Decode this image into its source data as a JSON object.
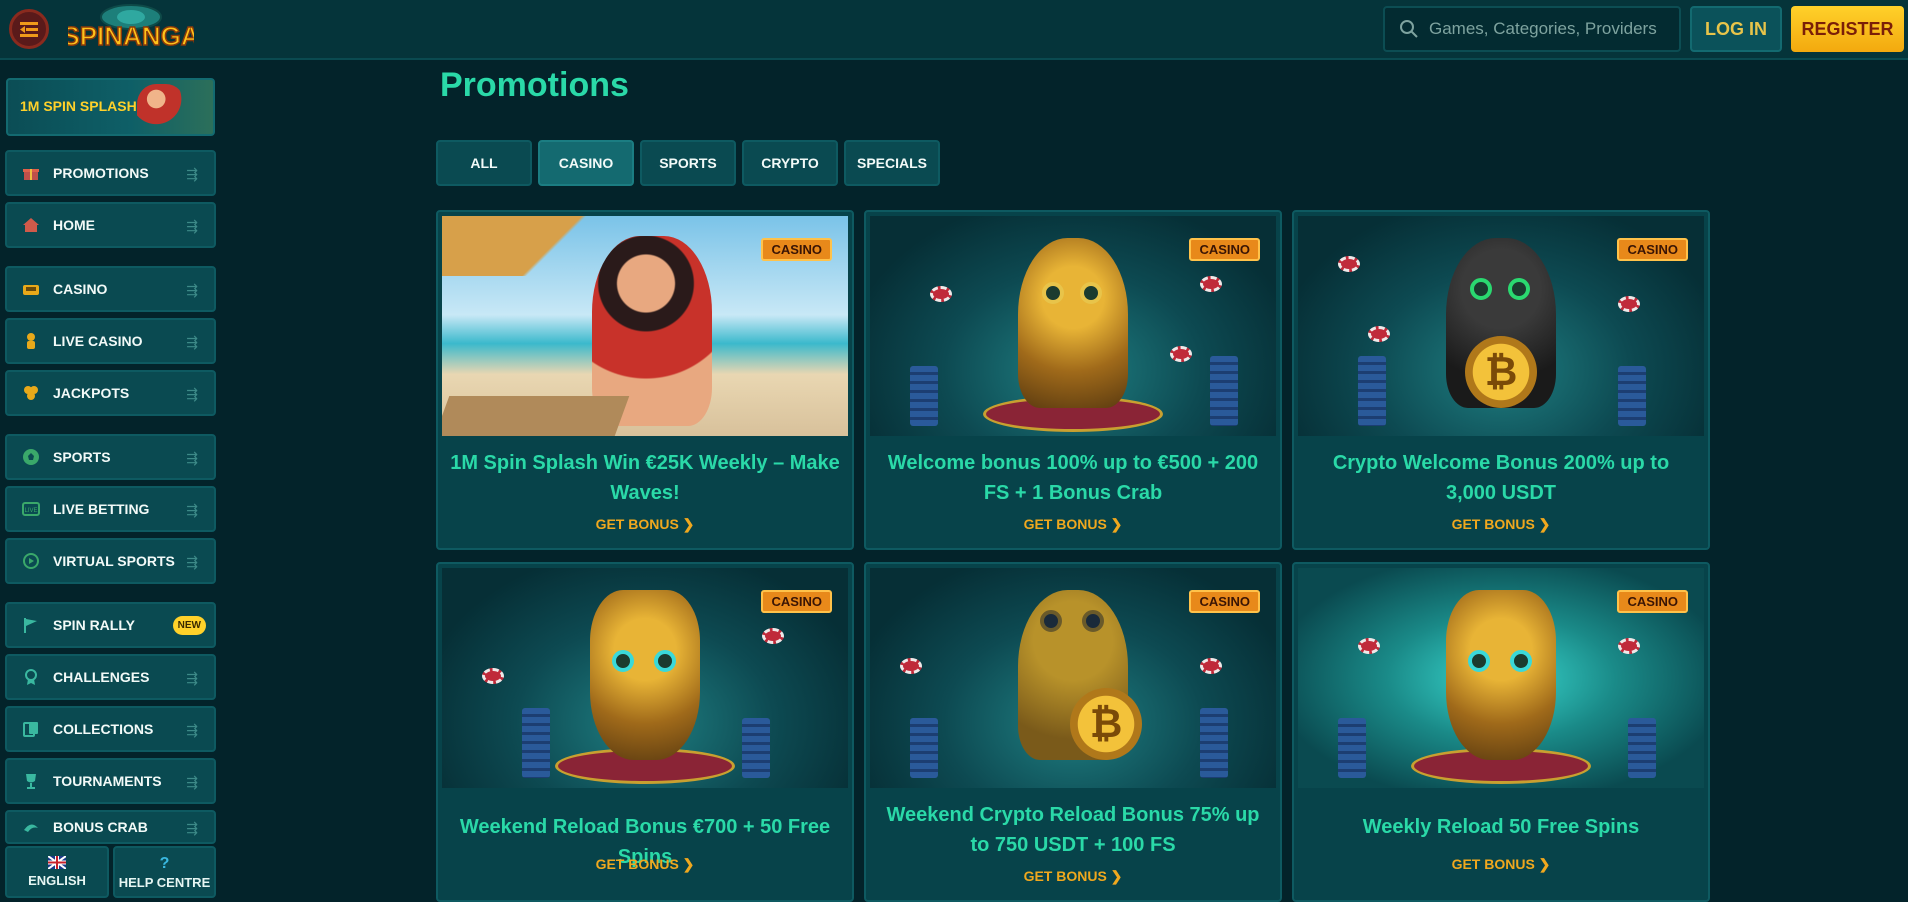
{
  "header": {
    "logo_text": "SPINANGA",
    "search_placeholder": "Games, Categories, Providers",
    "login_label": "LOG IN",
    "register_label": "REGISTER"
  },
  "sidebar": {
    "banner_label": "1M SPIN SPLASH",
    "items": [
      {
        "label": "PROMOTIONS",
        "icon": "gift-icon"
      },
      {
        "label": "HOME",
        "icon": "home-icon"
      },
      {
        "label": "CASINO",
        "icon": "casino-icon"
      },
      {
        "label": "LIVE CASINO",
        "icon": "dealer-icon"
      },
      {
        "label": "JACKPOTS",
        "icon": "jackpot-icon"
      },
      {
        "label": "SPORTS",
        "icon": "soccer-ball-icon"
      },
      {
        "label": "LIVE BETTING",
        "icon": "live-icon"
      },
      {
        "label": "VIRTUAL SPORTS",
        "icon": "virtual-sports-icon"
      },
      {
        "label": "SPIN RALLY",
        "icon": "flag-icon",
        "badge": "NEW"
      },
      {
        "label": "CHALLENGES",
        "icon": "medal-icon"
      },
      {
        "label": "COLLECTIONS",
        "icon": "cards-icon"
      },
      {
        "label": "TOURNAMENTS",
        "icon": "trophy-icon"
      },
      {
        "label": "BONUS CRAB",
        "icon": "crab-icon"
      }
    ],
    "language_label": "ENGLISH",
    "help_label": "HELP CENTRE",
    "help_glyph": "?"
  },
  "main": {
    "title": "Promotions",
    "tabs": [
      "ALL",
      "CASINO",
      "SPORTS",
      "CRYPTO",
      "SPECIALS"
    ],
    "active_tab": "CASINO",
    "cards": [
      {
        "badge": "CASINO",
        "title": "1M Spin Splash Win €25K Weekly – Make Waves!",
        "cta": "GET BONUS ❯",
        "art": "beach-character"
      },
      {
        "badge": "CASINO",
        "title": "Welcome bonus 100% up to €500 + 200 FS + 1 Bonus Crab",
        "cta": "GET BONUS ❯",
        "art": "monkey-idol"
      },
      {
        "badge": "CASINO",
        "title": "Crypto Welcome Bonus 200% up to 3,000 USDT",
        "cta": "GET BONUS ❯",
        "art": "panther-idol",
        "coin_glyph": "₿"
      },
      {
        "badge": "CASINO",
        "title": "Weekend Reload Bonus €700 + 50 Free Spins",
        "cta": "GET BONUS ❯",
        "art": "jaguar-mask"
      },
      {
        "badge": "CASINO",
        "title": "Weekend Crypto Reload Bonus 75% up to 750 USDT + 100 FS",
        "cta": "GET BONUS ❯",
        "art": "frog-idol",
        "coin_glyph": "₿"
      },
      {
        "badge": "CASINO",
        "title": "Weekly Reload 50 Free Spins",
        "cta": "GET BONUS ❯",
        "art": "jaguar-cards"
      }
    ]
  },
  "colors": {
    "accent_green": "#2ad9a8",
    "cta_orange": "#f0a81e",
    "register_yellow": "#ffd12a",
    "background": "#03232a"
  }
}
